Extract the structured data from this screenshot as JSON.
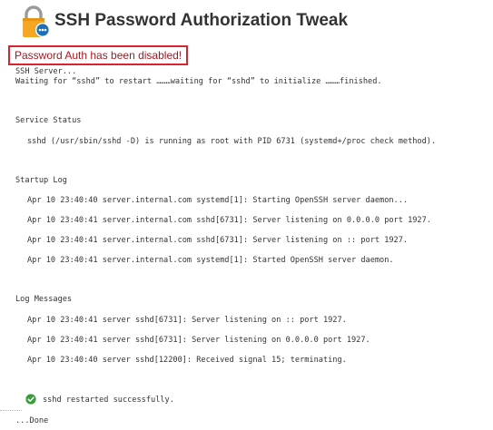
{
  "header": {
    "title": "SSH Password Authorization Tweak",
    "icon": "lock-icon",
    "badge_icon": "dots-badge-icon",
    "icon_color": "#f5a623",
    "badge_color": "#1d6fb8"
  },
  "alert": {
    "text": "Password Auth has been disabled!",
    "border_color": "#d9232e"
  },
  "ssh_server": {
    "line1": "SSH Server...",
    "line2": "Waiting for “sshd” to restart ………waiting for “sshd” to initialize ………finished."
  },
  "service_status": {
    "heading": "Service Status",
    "line": "sshd (/usr/sbin/sshd -D) is running as root with PID 6731 (systemd+/proc check method)."
  },
  "startup_log": {
    "heading": "Startup Log",
    "lines": [
      "Apr 10 23:40:40 server.internal.com systemd[1]: Starting OpenSSH server daemon...",
      "Apr 10 23:40:41 server.internal.com sshd[6731]: Server listening on 0.0.0.0 port 1927.",
      "Apr 10 23:40:41 server.internal.com sshd[6731]: Server listening on :: port 1927.",
      "Apr 10 23:40:41 server.internal.com systemd[1]: Started OpenSSH server daemon."
    ]
  },
  "log_messages": {
    "heading": "Log Messages",
    "lines": [
      "Apr 10 23:40:41 server sshd[6731]: Server listening on :: port 1927.",
      "Apr 10 23:40:41 server sshd[6731]: Server listening on 0.0.0.0 port 1927.",
      "Apr 10 23:40:40 server sshd[12200]: Received signal 15; terminating."
    ]
  },
  "result": {
    "icon": "check-circle-icon",
    "icon_color": "#3a9d3a",
    "message": "sshd restarted successfully.",
    "done": "...Done"
  }
}
